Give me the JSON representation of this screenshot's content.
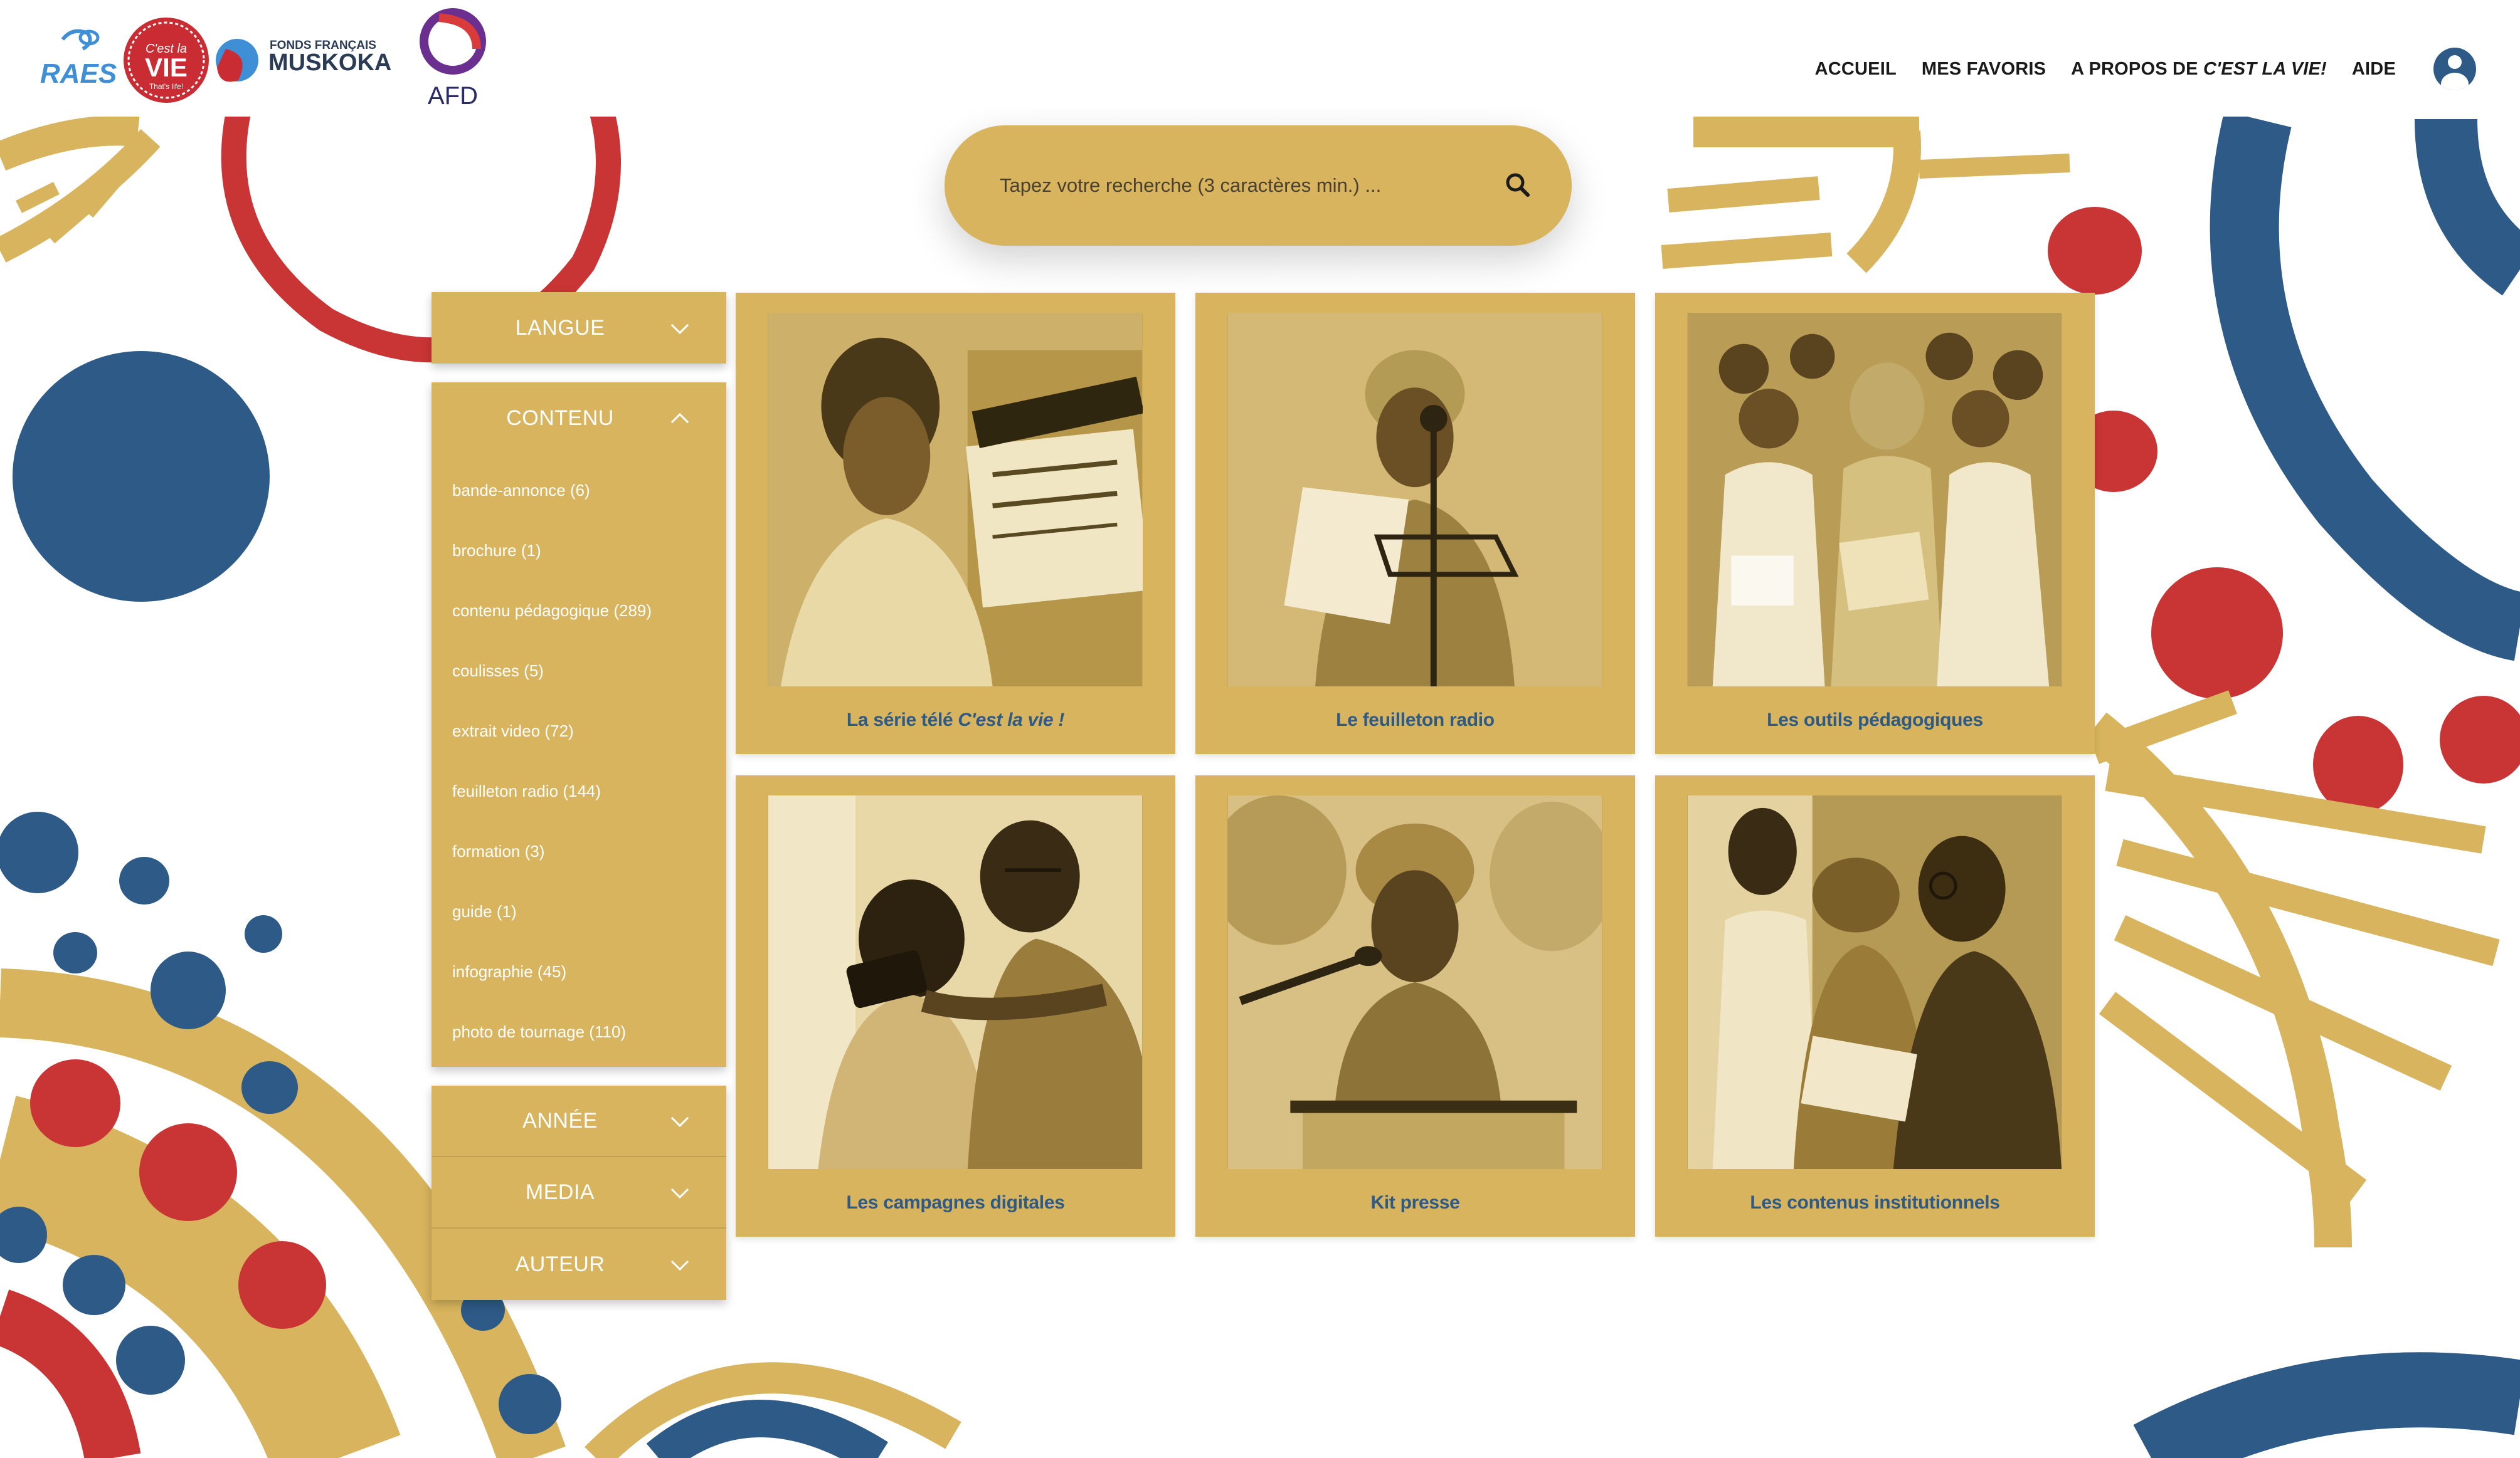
{
  "header": {
    "logos": [
      {
        "name": "raes",
        "text": "RAES"
      },
      {
        "name": "cest-la-vie",
        "text": "C'est la VIE",
        "subtext": "That's life!"
      },
      {
        "name": "muskoka",
        "text_small": "FONDS FRANÇAIS",
        "text": "MUSKOKA"
      },
      {
        "name": "afd",
        "text": "AFD"
      }
    ],
    "nav": {
      "home": "ACCUEIL",
      "favorites": "MES FAVORIS",
      "about_prefix": "A PROPOS DE ",
      "about_em": "C'EST LA VIE!",
      "help": "AIDE"
    }
  },
  "search": {
    "placeholder": "Tapez votre recherche (3 caractères min.) ..."
  },
  "filters": {
    "langue": {
      "label": "LANGUE",
      "expanded": false
    },
    "contenu": {
      "label": "CONTENU",
      "expanded": true,
      "items": [
        "bande-annonce (6)",
        "brochure (1)",
        "contenu pédagogique (289)",
        "coulisses (5)",
        "extrait video (72)",
        "feuilleton radio (144)",
        "formation (3)",
        "guide (1)",
        "infographie (45)",
        "photo de tournage (110)"
      ]
    },
    "annee": {
      "label": "ANNÉE",
      "expanded": false
    },
    "media": {
      "label": "MEDIA",
      "expanded": false
    },
    "auteur": {
      "label": "AUTEUR",
      "expanded": false
    }
  },
  "cards": [
    {
      "title": "La série télé",
      "title_em": "C'est la vie !"
    },
    {
      "title": "Le feuilleton radio",
      "title_em": ""
    },
    {
      "title": "Les outils pédagogiques",
      "title_em": ""
    },
    {
      "title": "Les campagnes digitales",
      "title_em": ""
    },
    {
      "title": "Kit presse",
      "title_em": ""
    },
    {
      "title": "Les contenus institutionnels",
      "title_em": ""
    }
  ],
  "colors": {
    "mustard": "#d7b45d",
    "blue": "#2d5a86",
    "red": "#c93535",
    "white": "#ffffff"
  },
  "icons": {
    "search": "magnifier-icon",
    "user": "user-avatar-icon",
    "collapse": "chevron-icon"
  }
}
